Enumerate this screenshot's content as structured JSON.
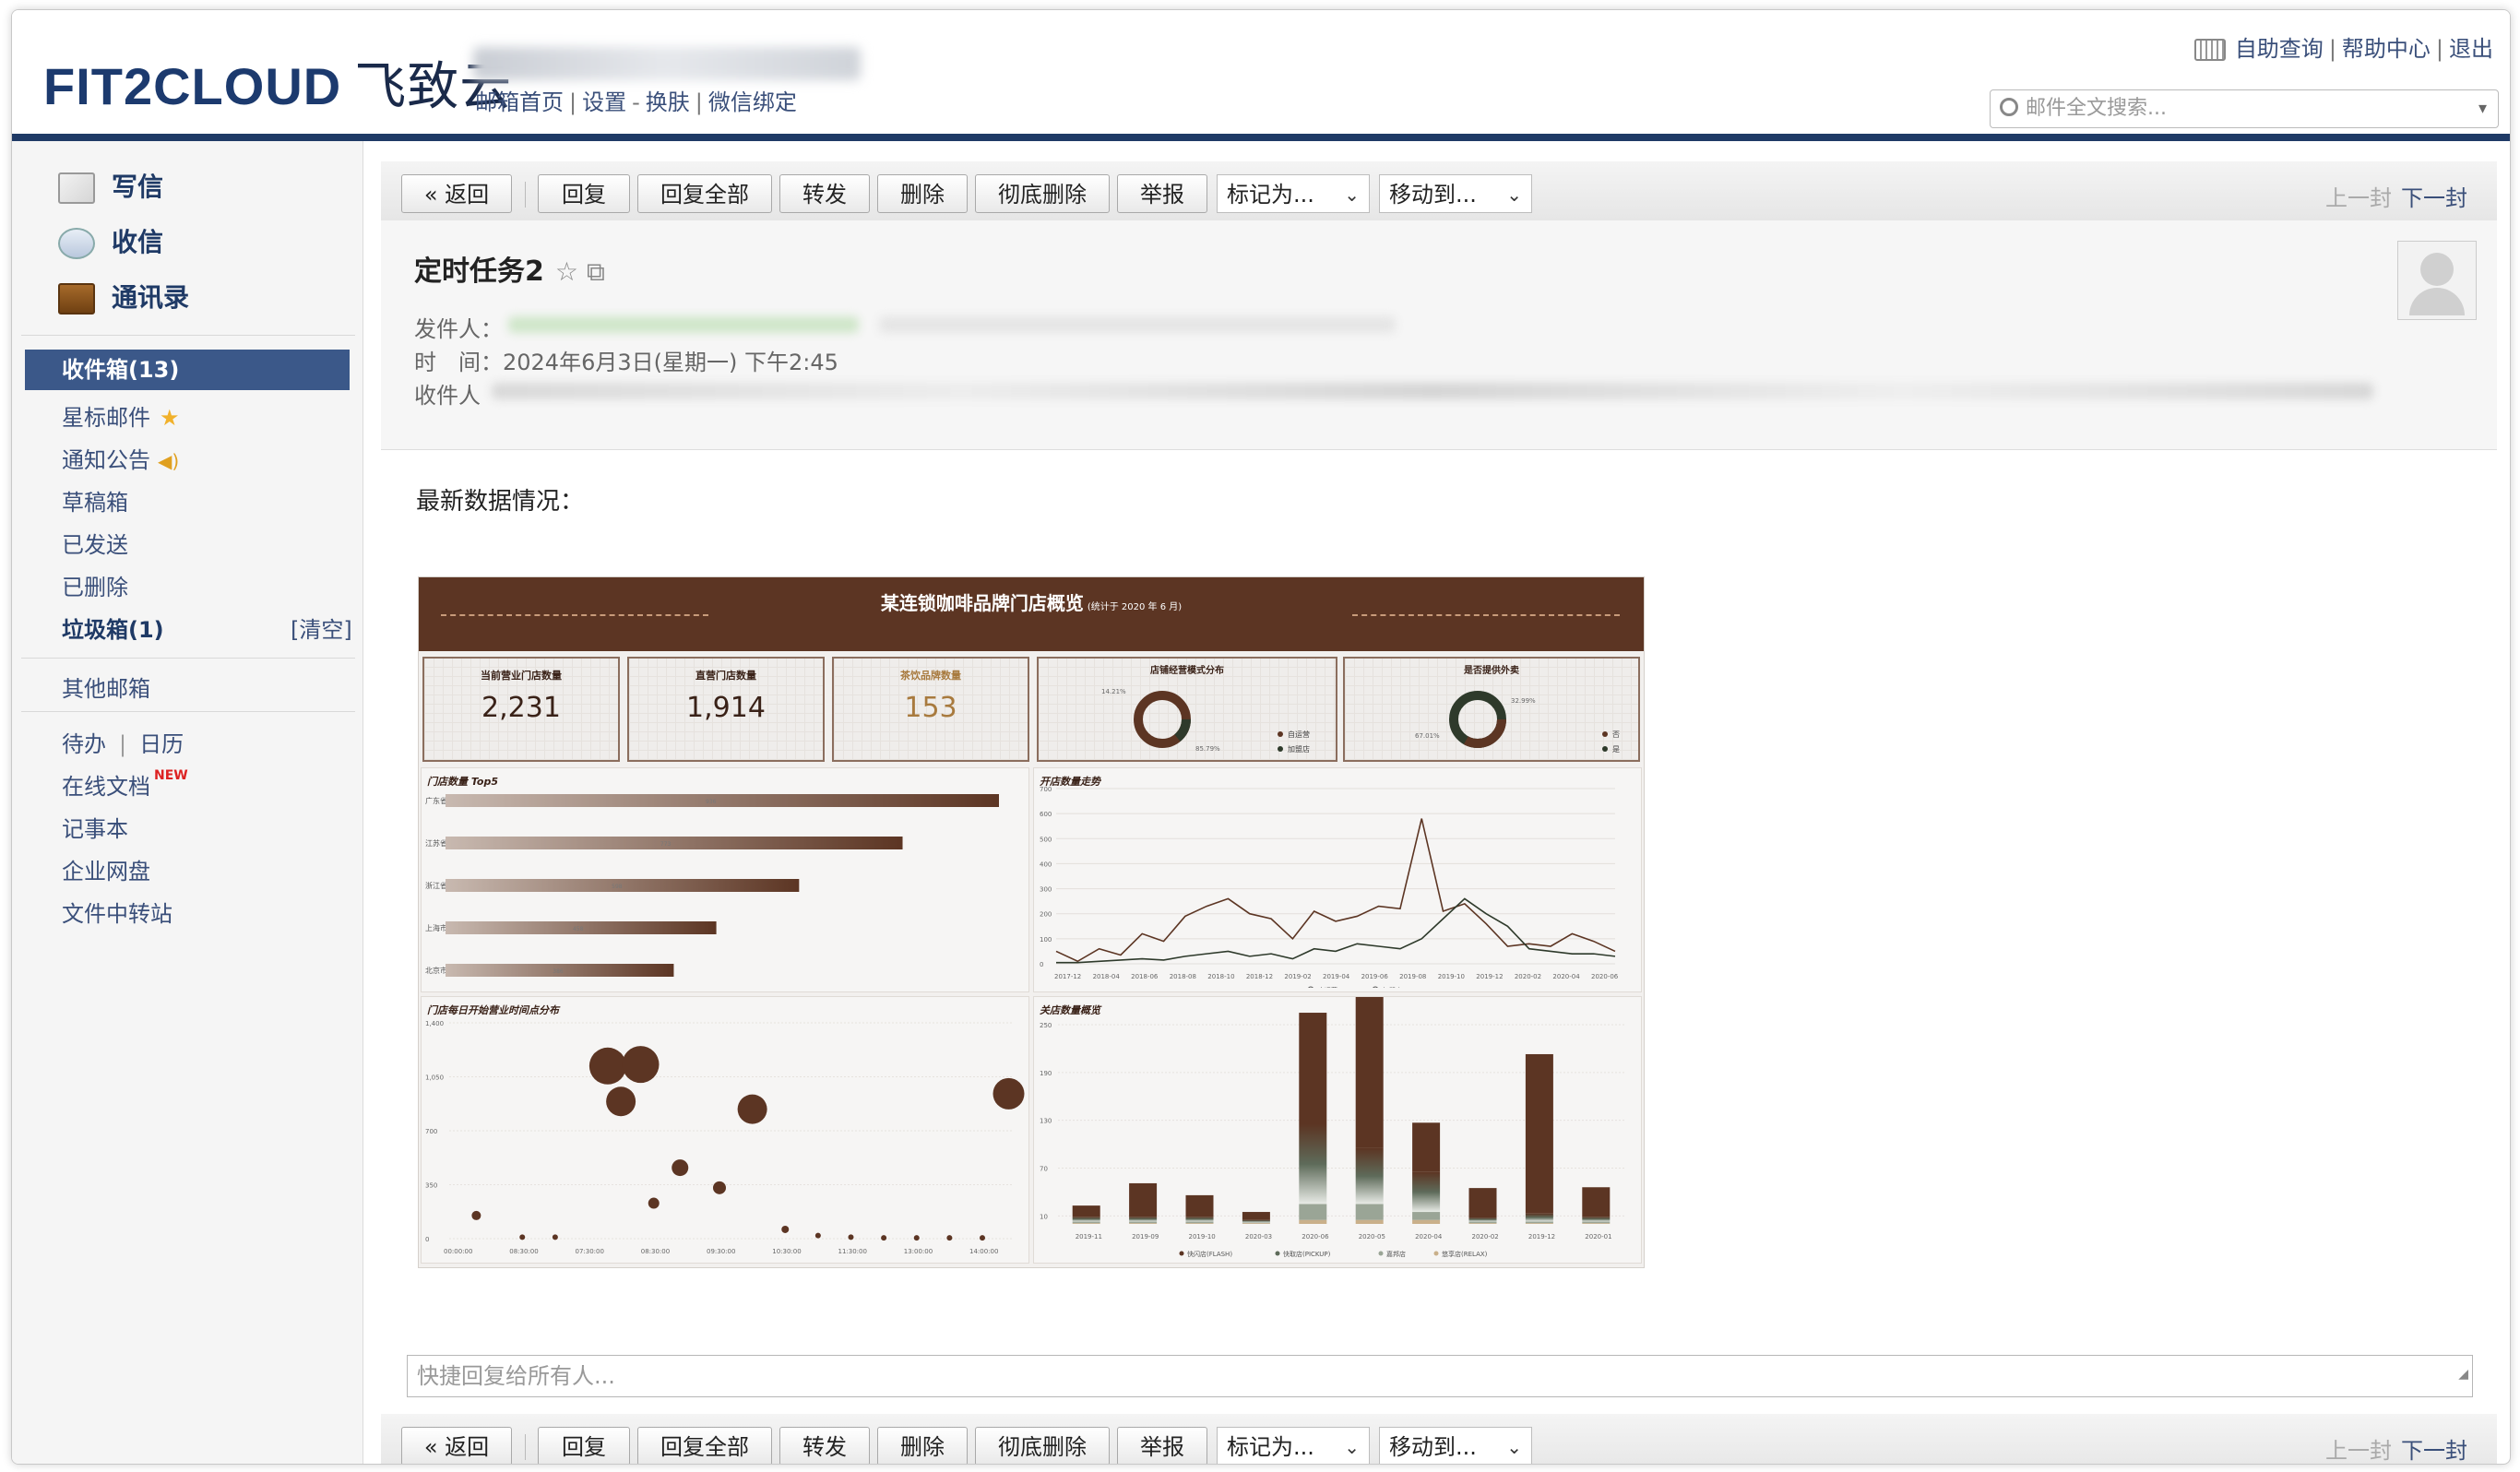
{
  "header": {
    "logo": "FIT2CLOUD",
    "logo_cn": "飞致云",
    "nav": [
      "邮箱首页",
      "设置",
      "换肤",
      "微信绑定"
    ],
    "top_links": [
      "自助查询",
      "帮助中心",
      "退出"
    ],
    "search_placeholder": "邮件全文搜索..."
  },
  "sidebar": {
    "compose": "写信",
    "receive": "收信",
    "contacts": "通讯录",
    "inbox": "收件箱(13)",
    "folders": [
      "星标邮件",
      "通知公告",
      "草稿箱",
      "已发送",
      "已删除"
    ],
    "spam": "垃圾箱(1)",
    "spam_clear": "[清空]",
    "other": "其他邮箱",
    "todo": "待办",
    "calendar": "日历",
    "docs": "在线文档",
    "docs_badge": "NEW",
    "notes": "记事本",
    "netdisk": "企业网盘",
    "transfer": "文件中转站"
  },
  "toolbar": {
    "back": "« 返回",
    "reply": "回复",
    "reply_all": "回复全部",
    "forward": "转发",
    "delete": "删除",
    "delete_perm": "彻底删除",
    "report": "举报",
    "mark_as": "标记为...",
    "move_to": "移动到...",
    "prev": "上一封",
    "next": "下一封"
  },
  "mail": {
    "subject": "定时任务2",
    "from_label": "发件人：",
    "time_label": "时　间：",
    "time_value": "2024年6月3日(星期一) 下午2:45",
    "to_label": "收件人",
    "body_intro": "最新数据情况："
  },
  "dashboard": {
    "title": "某连锁咖啡品牌门店概览",
    "subtitle": "(统计于 2020 年 6 月)",
    "kpis": [
      {
        "label": "当前营业门店数量",
        "value": "2,231"
      },
      {
        "label": "直营门店数量",
        "value": "1,914"
      },
      {
        "label": "茶饮品牌数量",
        "value": "153"
      }
    ],
    "donut1": {
      "title": "店铺经营模式分布",
      "labels": [
        "14.21%",
        "85.79%"
      ],
      "legend": [
        "自运营",
        "加盟店"
      ]
    },
    "donut2": {
      "title": "是否提供外卖",
      "labels": [
        "32.99%",
        "67.01%"
      ],
      "legend": [
        "否",
        "是"
      ]
    }
  },
  "chart_data": [
    {
      "type": "bar",
      "title": "门店数量 Top5",
      "categories": [
        "广东省",
        "江苏省",
        "浙江省",
        "上海市",
        "北京市"
      ],
      "values": [
        936,
        773,
        598,
        458,
        386
      ]
    },
    {
      "type": "line",
      "title": "开店数量走势",
      "x": [
        "2017-12",
        "2018-04",
        "2018-06",
        "2018-08",
        "2018-10",
        "2018-12",
        "2019-02",
        "2019-04",
        "2019-06",
        "2019-08",
        "2019-10",
        "2019-12",
        "2020-02",
        "2020-04",
        "2020-06"
      ],
      "ylim": [
        0,
        700
      ],
      "yticks": [
        0,
        100,
        200,
        300,
        400,
        500,
        600,
        700
      ],
      "series": [
        {
          "name": "自运营",
          "values": [
            50,
            10,
            60,
            35,
            120,
            90,
            190,
            230,
            260,
            200,
            180,
            100,
            210,
            170,
            190,
            230,
            220,
            580,
            210,
            240,
            160,
            70,
            80,
            70,
            120,
            90,
            50
          ]
        },
        {
          "name": "加盟店",
          "values": [
            5,
            5,
            10,
            15,
            20,
            15,
            30,
            40,
            50,
            30,
            40,
            20,
            60,
            50,
            80,
            70,
            60,
            100,
            180,
            260,
            200,
            150,
            60,
            50,
            40,
            40,
            30
          ]
        }
      ]
    },
    {
      "type": "scatter",
      "title": "门店每日开始营业时间点分布",
      "x": [
        "00:00:00",
        "08:30:00",
        "07:30:00",
        "08:30:00",
        "09:30:00",
        "10:30:00",
        "11:30:00",
        "13:00:00",
        "14:00:00"
      ],
      "ylim": [
        0,
        1400
      ],
      "yticks": [
        0,
        350,
        700,
        1050,
        1400
      ],
      "points": [
        {
          "x": 0.3,
          "y": 150,
          "r": 5
        },
        {
          "x": 1.0,
          "y": 10,
          "r": 3
        },
        {
          "x": 1.5,
          "y": 10,
          "r": 3
        },
        {
          "x": 2.3,
          "y": 1120,
          "r": 20
        },
        {
          "x": 2.5,
          "y": 890,
          "r": 16
        },
        {
          "x": 2.8,
          "y": 1130,
          "r": 20
        },
        {
          "x": 3.0,
          "y": 230,
          "r": 6
        },
        {
          "x": 3.4,
          "y": 460,
          "r": 9
        },
        {
          "x": 4.0,
          "y": 330,
          "r": 7
        },
        {
          "x": 4.5,
          "y": 840,
          "r": 16
        },
        {
          "x": 5.0,
          "y": 60,
          "r": 4
        },
        {
          "x": 5.5,
          "y": 20,
          "r": 3
        },
        {
          "x": 6.0,
          "y": 10,
          "r": 3
        },
        {
          "x": 6.5,
          "y": 5,
          "r": 3
        },
        {
          "x": 7.0,
          "y": 5,
          "r": 3
        },
        {
          "x": 7.5,
          "y": 5,
          "r": 3
        },
        {
          "x": 8.0,
          "y": 5,
          "r": 3
        },
        {
          "x": 8.4,
          "y": 940,
          "r": 17
        }
      ]
    },
    {
      "type": "bar",
      "title": "关店数量概览",
      "categories": [
        "2019-11",
        "2019-09",
        "2019-10",
        "2020-03",
        "2020-06",
        "2020-05",
        "2020-04",
        "2020-02",
        "2019-12",
        "2020-01"
      ],
      "ylim": [
        0,
        250
      ],
      "yticks": [
        10,
        70,
        130,
        190,
        250
      ],
      "series": [
        {
          "name": "快闪店(FLASH)",
          "values": [
            14,
            42,
            27,
            10,
            140,
            220,
            62,
            37,
            200,
            37
          ]
        },
        {
          "name": "快取店(PICKUP)",
          "values": [
            6,
            6,
            6,
            3,
            100,
            70,
            50,
            5,
            10,
            6
          ]
        },
        {
          "name": "嘉邦店",
          "values": [
            2,
            2,
            2,
            1,
            20,
            20,
            10,
            2,
            2,
            2
          ]
        },
        {
          "name": "悠享店(RELAX)",
          "values": [
            1,
            1,
            1,
            1,
            5,
            5,
            5,
            1,
            1,
            1
          ]
        }
      ]
    }
  ],
  "quick_reply_placeholder": "快捷回复给所有人...",
  "colors": {
    "brand": "#1f3a66",
    "dash_brown": "#5c3523",
    "bar_dark": "#5c3523"
  }
}
